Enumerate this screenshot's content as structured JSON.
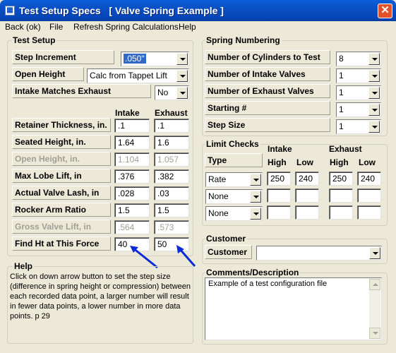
{
  "window": {
    "title": "Test Setup Specs   [ Valve Spring Example ]",
    "close": "✕",
    "icon": "app-window-icon"
  },
  "menu": [
    "Back (ok)",
    "File",
    "Refresh Spring Calculations",
    "Help"
  ],
  "test_setup": {
    "title": "Test Setup",
    "step_increment": {
      "label": "Step Increment",
      "value": ".050\""
    },
    "open_height": {
      "label": "Open Height",
      "value": "Calc from Tappet Lift"
    },
    "intake_matches_exhaust": {
      "label": "Intake Matches Exhaust",
      "value": "No"
    },
    "col_intake": "Intake",
    "col_exhaust": "Exhaust",
    "rows": [
      {
        "label": "Retainer Thickness, in.",
        "intake": ".1",
        "exhaust": ".1",
        "enabled": true
      },
      {
        "label": "Seated Height, in.",
        "intake": "1.64",
        "exhaust": "1.6",
        "enabled": true
      },
      {
        "label": "Open Height, in.",
        "intake": "1.104",
        "exhaust": "1.057",
        "enabled": false
      },
      {
        "label": "Max Lobe Lift, in",
        "intake": ".376",
        "exhaust": ".382",
        "enabled": true
      },
      {
        "label": "Actual Valve Lash, in",
        "intake": ".028",
        "exhaust": ".03",
        "enabled": true
      },
      {
        "label": "Rocker Arm Ratio",
        "intake": "1.5",
        "exhaust": "1.5",
        "enabled": true
      },
      {
        "label": "Gross Valve Lift, in",
        "intake": ".564",
        "exhaust": ".573",
        "enabled": false
      },
      {
        "label": "Find Ht at This Force",
        "intake": "40",
        "exhaust": "50",
        "enabled": true
      }
    ]
  },
  "help": {
    "title": "Help",
    "text": "Click on down arrow button to set the step size (difference in spring height or compression) between each recorded data point, a larger number will result in fewer data points, a lower number in more data points.  p 29"
  },
  "spring_numbering": {
    "title": "Spring Numbering",
    "rows": [
      {
        "label": "Number of Cylinders to Test",
        "value": "8"
      },
      {
        "label": "Number of Intake Valves",
        "value": "1"
      },
      {
        "label": "Number of Exhaust Valves",
        "value": "1"
      },
      {
        "label": "Starting #",
        "value": "1"
      },
      {
        "label": "Step Size",
        "value": "1"
      }
    ]
  },
  "limit_checks": {
    "title": "Limit Checks",
    "type_label": "Type",
    "intake_label": "Intake",
    "exhaust_label": "Exhaust",
    "high": "High",
    "low": "Low",
    "rows": [
      {
        "type": "Rate",
        "intake_high": "250",
        "intake_low": "240",
        "exhaust_high": "250",
        "exhaust_low": "240"
      },
      {
        "type": "None",
        "intake_high": "",
        "intake_low": "",
        "exhaust_high": "",
        "exhaust_low": ""
      },
      {
        "type": "None",
        "intake_high": "",
        "intake_low": "",
        "exhaust_high": "",
        "exhaust_low": ""
      }
    ]
  },
  "customer": {
    "title": "Customer",
    "label": "Customer",
    "value": ""
  },
  "comments": {
    "title": "Comments/Description",
    "value": "Example of a test configuration file"
  },
  "colors": {
    "title_bar": "#0a4fc4",
    "selection": "#316ac5",
    "arrow": "#0b2bd8",
    "face": "#ece9d8"
  }
}
